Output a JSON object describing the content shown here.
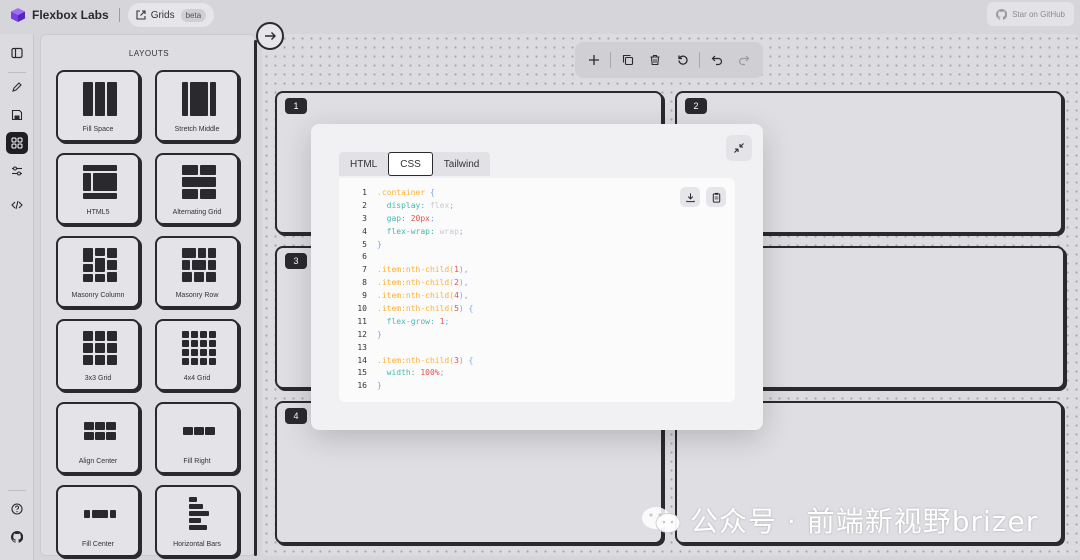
{
  "header": {
    "brand_name": "Flexbox Labs",
    "grids_label": "Grids",
    "beta_badge": "beta",
    "github_label": "Star on GitHub"
  },
  "rail": {
    "icons": [
      "sidebar-toggle-icon",
      "pencil-icon",
      "save-icon",
      "layouts-grid-icon",
      "settings-sliders-icon",
      "code-icon",
      "help-icon",
      "github-icon"
    ],
    "active": "layouts-grid-icon"
  },
  "layouts_panel": {
    "title": "LAYOUTS",
    "items": [
      {
        "label": "Fill Space",
        "icon": "fill-space-icon"
      },
      {
        "label": "Stretch Middle",
        "icon": "stretch-middle-icon"
      },
      {
        "label": "HTML5",
        "icon": "html5-layout-icon"
      },
      {
        "label": "Alternating Grid",
        "icon": "alternating-grid-icon"
      },
      {
        "label": "Masonry Column",
        "icon": "masonry-column-icon"
      },
      {
        "label": "Masonry Row",
        "icon": "masonry-row-icon"
      },
      {
        "label": "3x3 Grid",
        "icon": "grid-3x3-icon"
      },
      {
        "label": "4x4 Grid",
        "icon": "grid-4x4-icon"
      },
      {
        "label": "Align Center",
        "icon": "align-center-icon"
      },
      {
        "label": "Fill Right",
        "icon": "fill-right-icon"
      },
      {
        "label": "Fill Center",
        "icon": "fill-center-icon"
      },
      {
        "label": "Horizontal Bars",
        "icon": "horizontal-bars-icon"
      }
    ]
  },
  "toolbar": {
    "buttons": [
      "add-icon",
      "duplicate-icon",
      "delete-icon",
      "reset-icon",
      "undo-icon",
      "redo-icon"
    ]
  },
  "grid_items": [
    "1",
    "2",
    "3",
    "4"
  ],
  "code_modal": {
    "tabs": [
      "HTML",
      "CSS",
      "Tailwind"
    ],
    "active_tab": "CSS",
    "lines": [
      {
        "n": "1",
        "parts": [
          {
            "t": ".container",
            "c": "sel"
          },
          {
            "t": " {",
            "c": "pun"
          }
        ]
      },
      {
        "n": "2",
        "parts": [
          {
            "t": "  display:",
            "c": "prop"
          },
          {
            "t": " flex",
            "c": "kw"
          },
          {
            "t": ";",
            "c": "pun"
          }
        ]
      },
      {
        "n": "3",
        "parts": [
          {
            "t": "  gap:",
            "c": "prop"
          },
          {
            "t": " 20px",
            "c": "val"
          },
          {
            "t": ";",
            "c": "pun"
          }
        ]
      },
      {
        "n": "4",
        "parts": [
          {
            "t": "  flex-wrap:",
            "c": "prop"
          },
          {
            "t": " wrap",
            "c": "kw"
          },
          {
            "t": ";",
            "c": "pun"
          }
        ]
      },
      {
        "n": "5",
        "parts": [
          {
            "t": "}",
            "c": "pun"
          }
        ]
      },
      {
        "n": "6",
        "parts": []
      },
      {
        "n": "7",
        "parts": [
          {
            "t": ".item:nth-child(",
            "c": "sel"
          },
          {
            "t": "1",
            "c": "val"
          },
          {
            "t": "),",
            "c": "pun"
          }
        ]
      },
      {
        "n": "8",
        "parts": [
          {
            "t": ".item:nth-child(",
            "c": "sel"
          },
          {
            "t": "2",
            "c": "val"
          },
          {
            "t": "),",
            "c": "pun"
          }
        ]
      },
      {
        "n": "9",
        "parts": [
          {
            "t": ".item:nth-child(",
            "c": "sel"
          },
          {
            "t": "4",
            "c": "val"
          },
          {
            "t": "),",
            "c": "pun"
          }
        ]
      },
      {
        "n": "10",
        "parts": [
          {
            "t": ".item:nth-child(",
            "c": "sel"
          },
          {
            "t": "5",
            "c": "val"
          },
          {
            "t": ") {",
            "c": "pun"
          }
        ]
      },
      {
        "n": "11",
        "parts": [
          {
            "t": "  flex-grow:",
            "c": "prop"
          },
          {
            "t": " 1",
            "c": "val"
          },
          {
            "t": ";",
            "c": "pun"
          }
        ]
      },
      {
        "n": "12",
        "parts": [
          {
            "t": "}",
            "c": "pun"
          }
        ]
      },
      {
        "n": "13",
        "parts": []
      },
      {
        "n": "14",
        "parts": [
          {
            "t": ".item:nth-child(",
            "c": "sel"
          },
          {
            "t": "3",
            "c": "val"
          },
          {
            "t": ") {",
            "c": "pun"
          }
        ]
      },
      {
        "n": "15",
        "parts": [
          {
            "t": "  width:",
            "c": "prop"
          },
          {
            "t": " 100%",
            "c": "val"
          },
          {
            "t": ";",
            "c": "pun"
          }
        ]
      },
      {
        "n": "16",
        "parts": [
          {
            "t": "}",
            "c": "pun"
          }
        ]
      }
    ]
  },
  "watermark": {
    "text": "公众号 · 前端新视野brizer"
  }
}
